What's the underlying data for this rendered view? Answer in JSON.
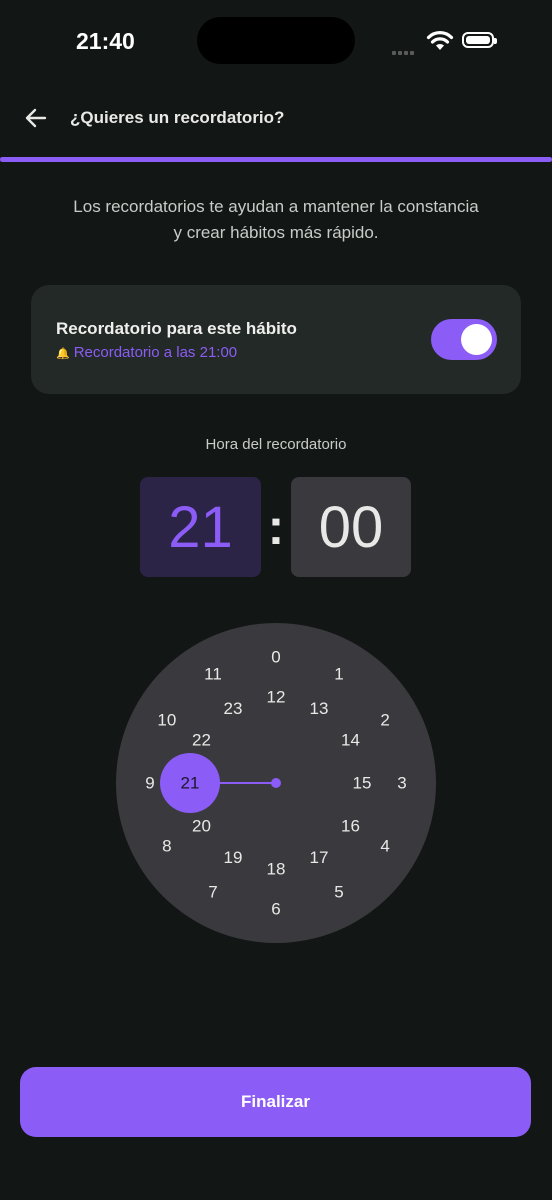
{
  "status_bar": {
    "time": "21:40"
  },
  "header": {
    "title": "¿Quieres un recordatorio?",
    "progress": 1.0
  },
  "description": {
    "line1": "Los recordatorios te ayudan a mantener la constancia",
    "line2": "y crear hábitos más rápido."
  },
  "reminder_card": {
    "title": "Recordatorio para este hábito",
    "subtitle": "Recordatorio a las 21:00",
    "enabled": true
  },
  "time_picker": {
    "label": "Hora del recordatorio",
    "hour": "21",
    "separator": ":",
    "minute": "00"
  },
  "clock": {
    "outer": [
      "0",
      "1",
      "2",
      "3",
      "4",
      "5",
      "6",
      "7",
      "8",
      "9",
      "10",
      "11"
    ],
    "inner": [
      "12",
      "13",
      "14",
      "15",
      "16",
      "17",
      "18",
      "19",
      "20",
      "21",
      "22",
      "23"
    ],
    "selected": "21"
  },
  "footer": {
    "finish_label": "Finalizar"
  },
  "colors": {
    "accent": "#8b5cf6",
    "background": "#121614",
    "card": "#232927",
    "dial": "#3a3a3e"
  }
}
